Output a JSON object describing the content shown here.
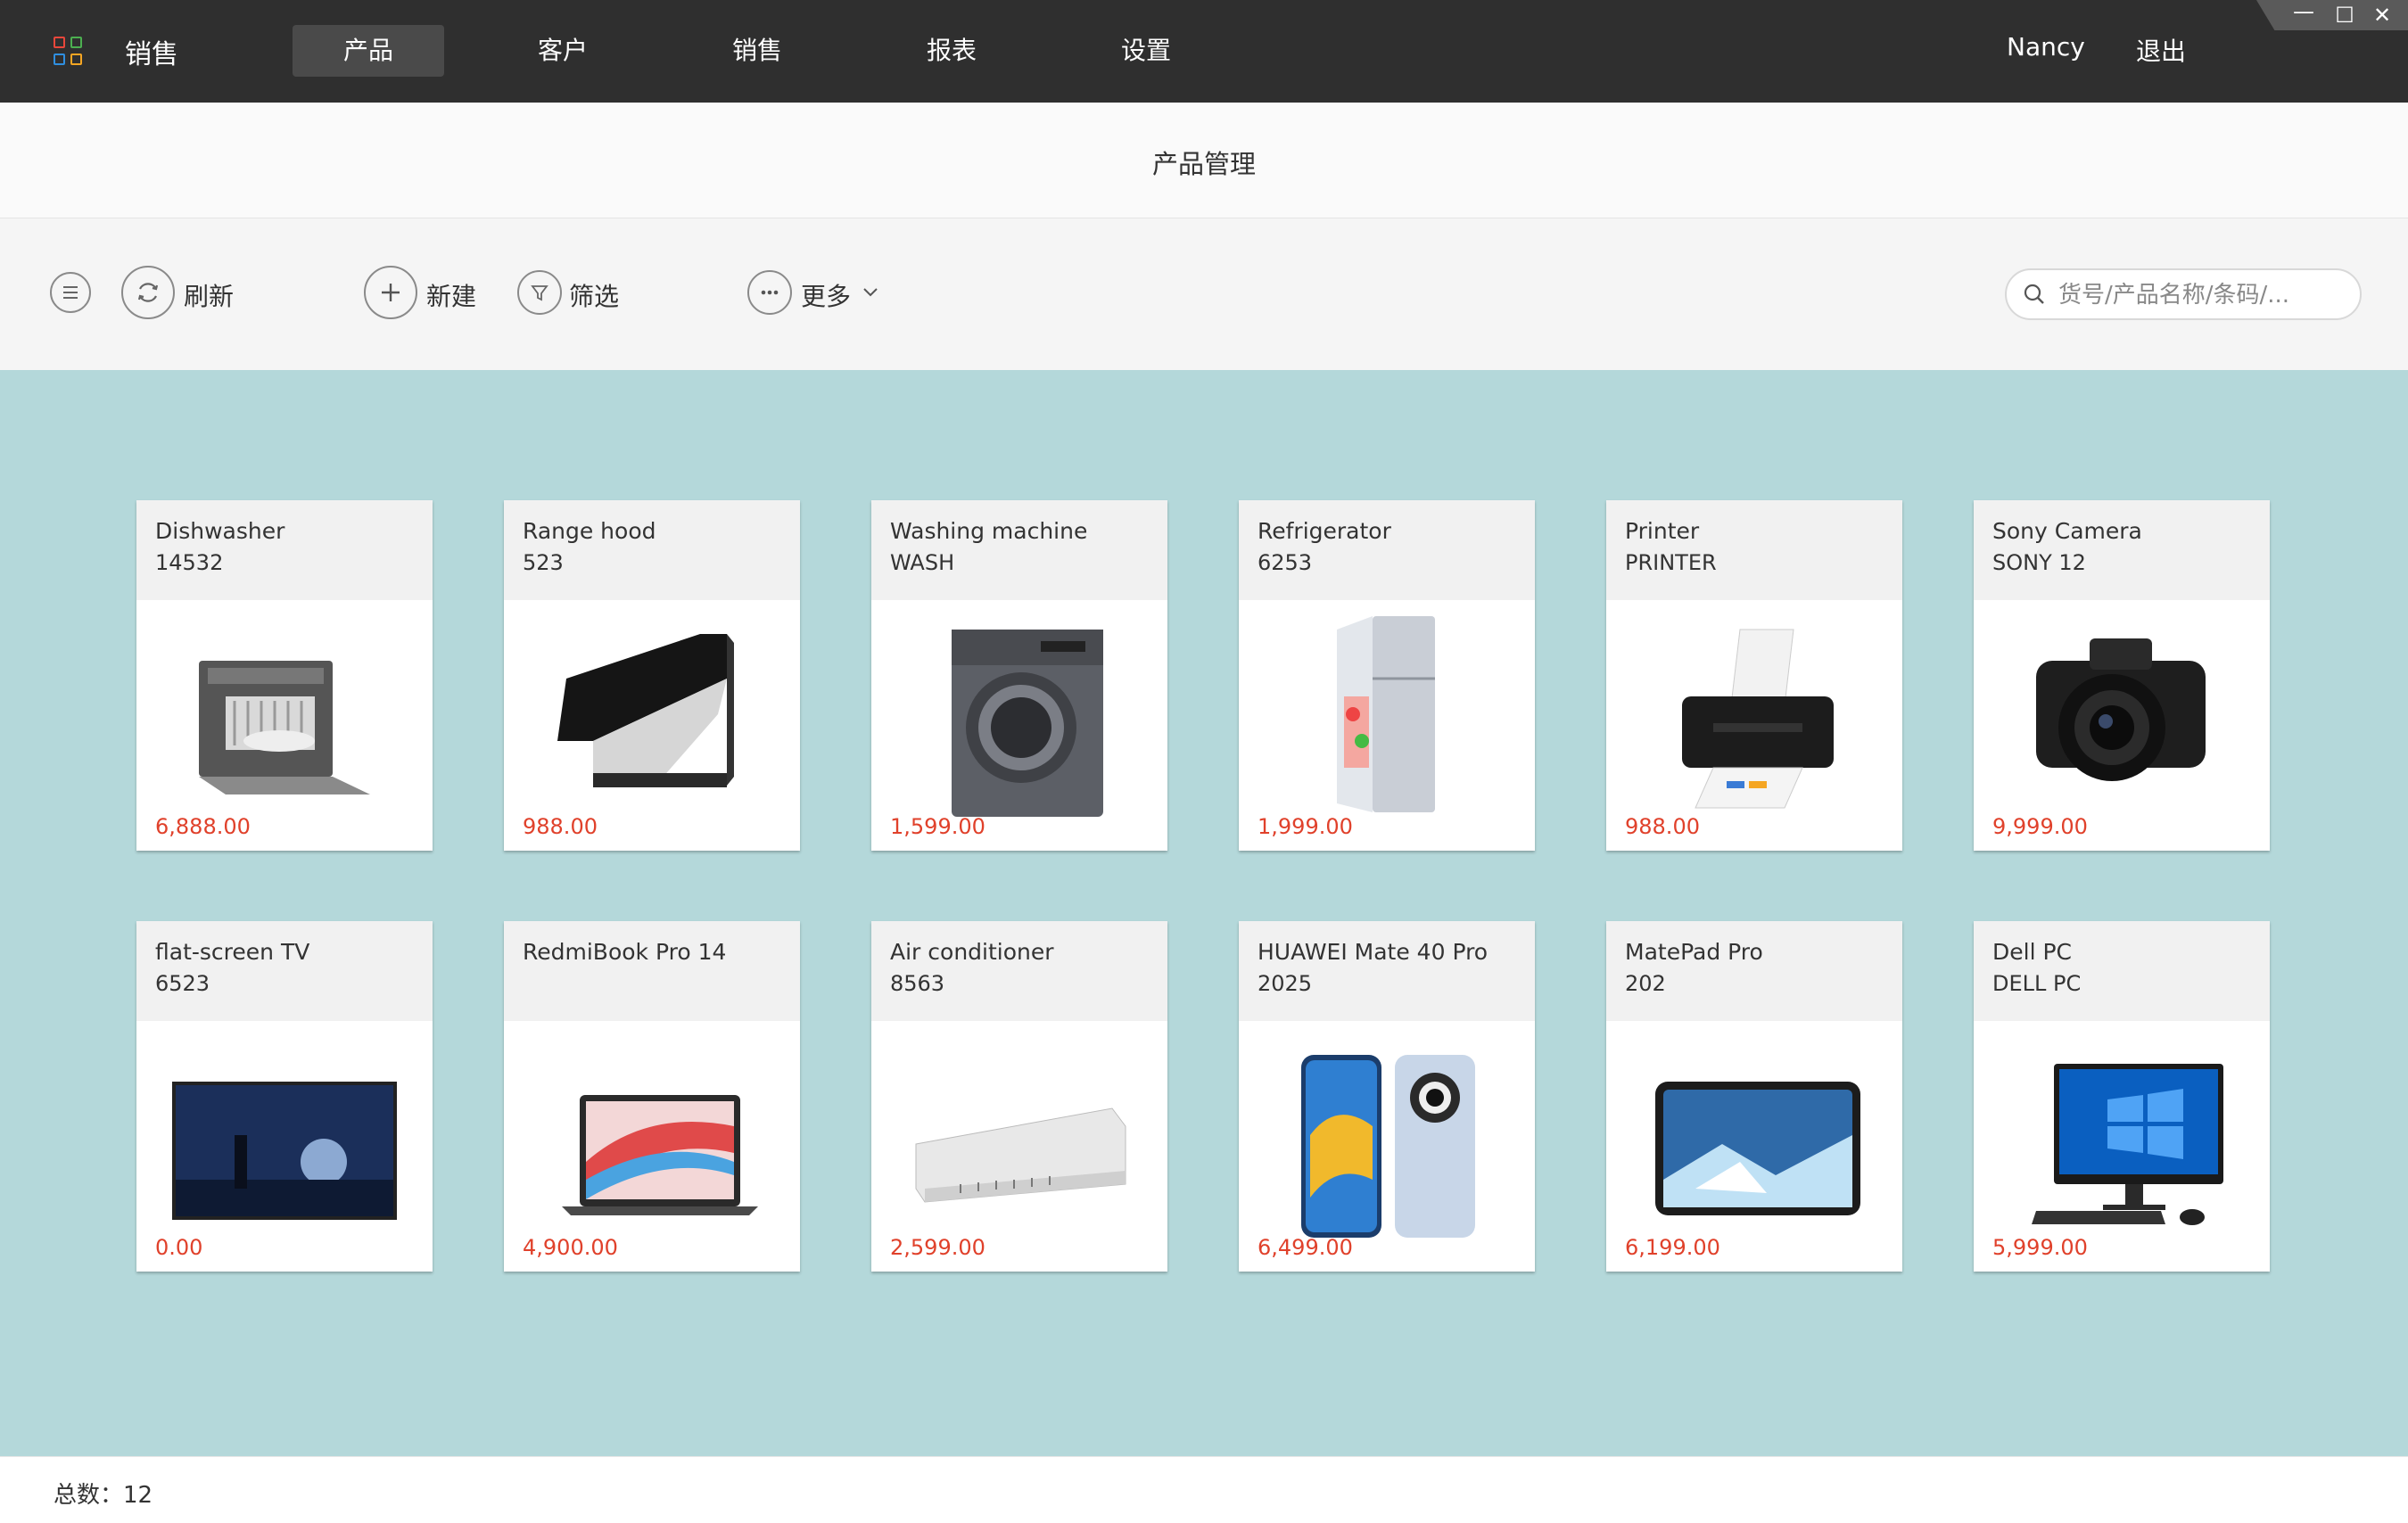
{
  "app": {
    "title": "销售"
  },
  "nav": {
    "items": [
      {
        "label": "产品",
        "active": true
      },
      {
        "label": "客户",
        "active": false
      },
      {
        "label": "销售",
        "active": false
      },
      {
        "label": "报表",
        "active": false
      },
      {
        "label": "设置",
        "active": false
      }
    ]
  },
  "user": {
    "name": "Nancy",
    "logout_label": "退出"
  },
  "window_controls": {
    "minimize": "—",
    "maximize": "☐",
    "close": "✕"
  },
  "page": {
    "title": "产品管理"
  },
  "toolbar": {
    "refresh_label": "刷新",
    "new_label": "新建",
    "filter_label": "筛选",
    "more_label": "更多"
  },
  "search": {
    "placeholder": "货号/产品名称/条码/..."
  },
  "products": [
    {
      "name": "Dishwasher",
      "code": "14532",
      "price": "6,888.00",
      "icon": "dishwasher-image"
    },
    {
      "name": "Range hood",
      "code": "523",
      "price": "988.00",
      "icon": "range-hood-image"
    },
    {
      "name": "Washing machine",
      "code": "WASH",
      "price": "1,599.00",
      "icon": "washing-machine-image"
    },
    {
      "name": "Refrigerator",
      "code": "6253",
      "price": "1,999.00",
      "icon": "refrigerator-image"
    },
    {
      "name": "Printer",
      "code": "PRINTER",
      "price": "988.00",
      "icon": "printer-image"
    },
    {
      "name": "Sony Camera",
      "code": "SONY 12",
      "price": "9,999.00",
      "icon": "camera-image"
    },
    {
      "name": "flat-screen TV",
      "code": "6523",
      "price": "0.00",
      "icon": "tv-image"
    },
    {
      "name": "RedmiBook Pro 14",
      "code": "",
      "price": "4,900.00",
      "icon": "laptop-image"
    },
    {
      "name": "Air conditioner",
      "code": "8563",
      "price": "2,599.00",
      "icon": "air-conditioner-image"
    },
    {
      "name": "HUAWEI Mate 40 Pro",
      "code": "2025",
      "price": "6,499.00",
      "icon": "phone-image"
    },
    {
      "name": "MatePad Pro",
      "code": "202",
      "price": "6,199.00",
      "icon": "tablet-image"
    },
    {
      "name": "Dell PC",
      "code": "DELL PC",
      "price": "5,999.00",
      "icon": "desktop-pc-image"
    }
  ],
  "footer": {
    "total_label": "总数：12"
  },
  "colors": {
    "topbar": "#2f2f2f",
    "content_bg": "#b4d8da",
    "price": "#e0412b"
  }
}
